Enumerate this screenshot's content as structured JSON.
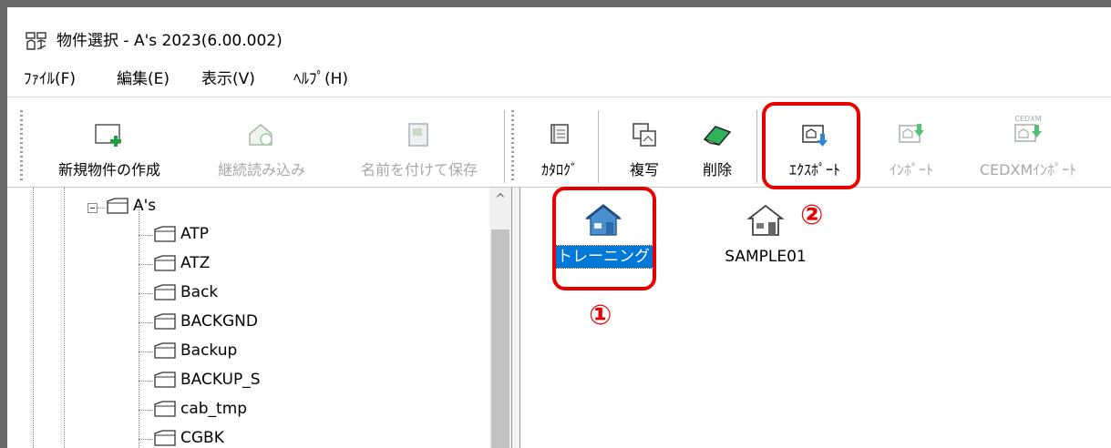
{
  "window": {
    "title": "物件選択 - A's 2023(6.00.002)"
  },
  "menu": [
    {
      "label": "ﾌｧｲﾙ(F)"
    },
    {
      "label": "編集(E)"
    },
    {
      "label": "表示(V)"
    },
    {
      "label": "ﾍﾙﾌﾟ(H)"
    }
  ],
  "toolbar": {
    "new_label": "新規物件の作成",
    "continue_label": "継続読み込み",
    "saveas_label": "名前を付けて保存",
    "catalog_label": "ｶﾀﾛｸﾞ",
    "copy_label": "複写",
    "delete_label": "削除",
    "export_label": "ｴｸｽﾎﾟｰﾄ",
    "import_label": "ｲﾝﾎﾟｰﾄ",
    "cedxm_import_label": "CEDXMｲﾝﾎﾟｰﾄ",
    "cedxm_icon_text": "CEDXM"
  },
  "tree": {
    "root": "A's",
    "children": [
      "ATP",
      "ATZ",
      "Back",
      "BACKGND",
      "Backup",
      "BACKUP_S",
      "cab_tmp",
      "CGBK"
    ]
  },
  "list": {
    "items": [
      {
        "label": "トレーニング",
        "selected": true
      },
      {
        "label": "SAMPLE01",
        "selected": false
      }
    ]
  },
  "annotations": {
    "marker1": "①",
    "marker2": "②",
    "color": "#e60000"
  },
  "colors": {
    "selection": "#0078d7",
    "house_roof": "#3a86c8",
    "disabled_text": "#a8a8a8"
  }
}
